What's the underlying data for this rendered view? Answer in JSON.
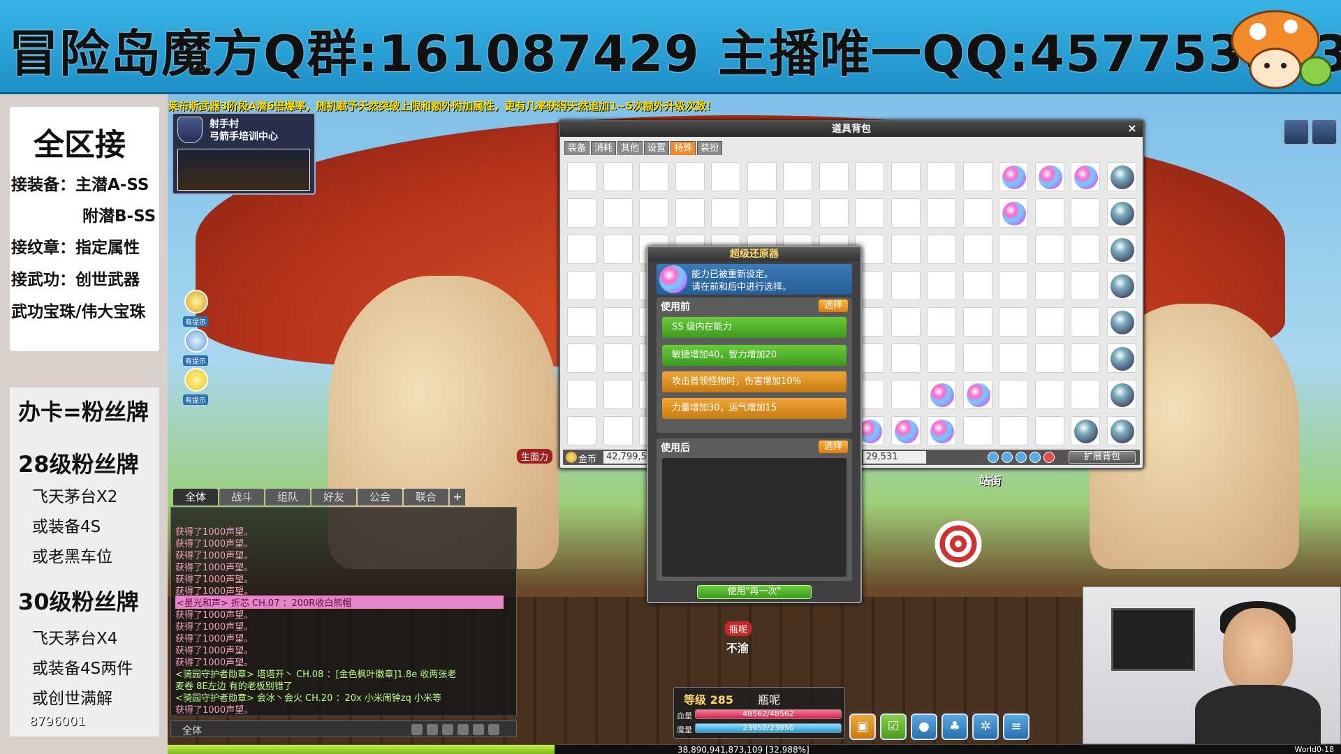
{
  "banner": {
    "text": "冒险岛魔方Q群:161087429  主播唯一QQ:457753803"
  },
  "promo": {
    "title": "全区接",
    "lines": [
      "接装备：主潜A-SS",
      "附潜B-SS",
      "接纹章：指定属性",
      "接武功：创世武器",
      "武功宝珠/伟大宝珠"
    ],
    "card": "办卡=粉丝牌",
    "tier28": "28级粉丝牌",
    "tier28_items": [
      "飞天茅台X2",
      "或装备4S",
      "或老黑车位"
    ],
    "tier30": "30级粉丝牌",
    "tier30_items": [
      "飞天茅台X4",
      "或装备4S两件",
      "或创世满解"
    ],
    "number": "8796001"
  },
  "notice": "莱布斯武器3阶段A潜6倍爆率，随机赋予天然突破上限和额外附加属性，更有几率获得天然追加1~5次额外升级次数！",
  "location": {
    "line1": "射手村",
    "line2": "弓箭手培训中心"
  },
  "inventory": {
    "title": "道具背包",
    "close": "×",
    "tabs": [
      {
        "label": "装备",
        "active": false
      },
      {
        "label": "消耗",
        "active": false
      },
      {
        "label": "其他",
        "active": false
      },
      {
        "label": "设置",
        "active": false
      },
      {
        "label": "特殊",
        "active": true
      },
      {
        "label": "装扮",
        "active": false
      }
    ],
    "meso_label": "金币",
    "meso": "42,799,5",
    "points": "29,531",
    "expand": "扩展背包"
  },
  "cube": {
    "title": "超级还原器",
    "msg1": "能力已被重新设定。",
    "msg2": "请在前和后中进行选择。",
    "before_label": "使用前",
    "after_label": "使用后",
    "select": "选择",
    "options": [
      {
        "text": "SS 级内在能力",
        "color": "green"
      },
      {
        "text": "敏捷增加40，智力增加20",
        "color": "green"
      },
      {
        "text": "攻击首领怪物时，伤害增加10%",
        "color": "orange"
      },
      {
        "text": "力量增加30，运气增加15",
        "color": "orange"
      }
    ],
    "retry": "使用\"再一次\""
  },
  "chat": {
    "tabs": [
      {
        "label": "全体",
        "active": true
      },
      {
        "label": "战斗",
        "active": false
      },
      {
        "label": "组队",
        "active": false
      },
      {
        "label": "好友",
        "active": false
      },
      {
        "label": "公会",
        "active": false
      },
      {
        "label": "联合",
        "active": false
      }
    ],
    "add": "+",
    "lines": [
      {
        "text": "获得了1000声望。",
        "kind": "normal"
      },
      {
        "text": "获得了1000声望。",
        "kind": "normal"
      },
      {
        "text": "获得了1000声望。",
        "kind": "normal"
      },
      {
        "text": "获得了1000声望。",
        "kind": "normal"
      },
      {
        "text": "获得了1000声望。",
        "kind": "normal"
      },
      {
        "text": "获得了1000声望。",
        "kind": "normal"
      },
      {
        "text": "<星光和声> 折芯 CH.07 ：200R收白熊帽",
        "kind": "hl"
      },
      {
        "text": "获得了1000声望。",
        "kind": "normal"
      },
      {
        "text": "获得了1000声望。",
        "kind": "normal"
      },
      {
        "text": "获得了1000声望。",
        "kind": "normal"
      },
      {
        "text": "获得了1000声望。",
        "kind": "normal"
      },
      {
        "text": "获得了1000声望。",
        "kind": "normal"
      },
      {
        "text": "<骑园守护者勋章> 塔塔开丶 CH.08 ：[金色枫叶徽章]1.8e 收两张老",
        "kind": "guild"
      },
      {
        "text": "麦卷  8E左边 有的老板别错了",
        "kind": "guild"
      },
      {
        "text": "<骑园守护者勋章> 会冰丶会火 CH.20 ：20x 小米闹钟zq  小米等",
        "kind": "guild"
      },
      {
        "text": "获得了1000声望。",
        "kind": "normal"
      }
    ],
    "input_label": "全体"
  },
  "status": {
    "level": "等级 285",
    "name": "瓶呢",
    "hp_label": "血量",
    "hp": "48562/48562",
    "hp_pct": 1,
    "mp_label": "魔量",
    "mp": "23950/23950",
    "mp_pct": 1
  },
  "exp": {
    "text": "38,890,941,873,109 [32.988%]",
    "pct": 0.32988,
    "world": "World0-18"
  },
  "scene": {
    "npc1": "站街",
    "npc2": "不渝",
    "tag": "瓶呢",
    "tag2": "生面力",
    "side_label": "有提示"
  },
  "colors": {
    "banner": "#2aa6dc",
    "accent": "#f08a2a",
    "green": "#4aaa24",
    "notice": "#ffe100"
  }
}
